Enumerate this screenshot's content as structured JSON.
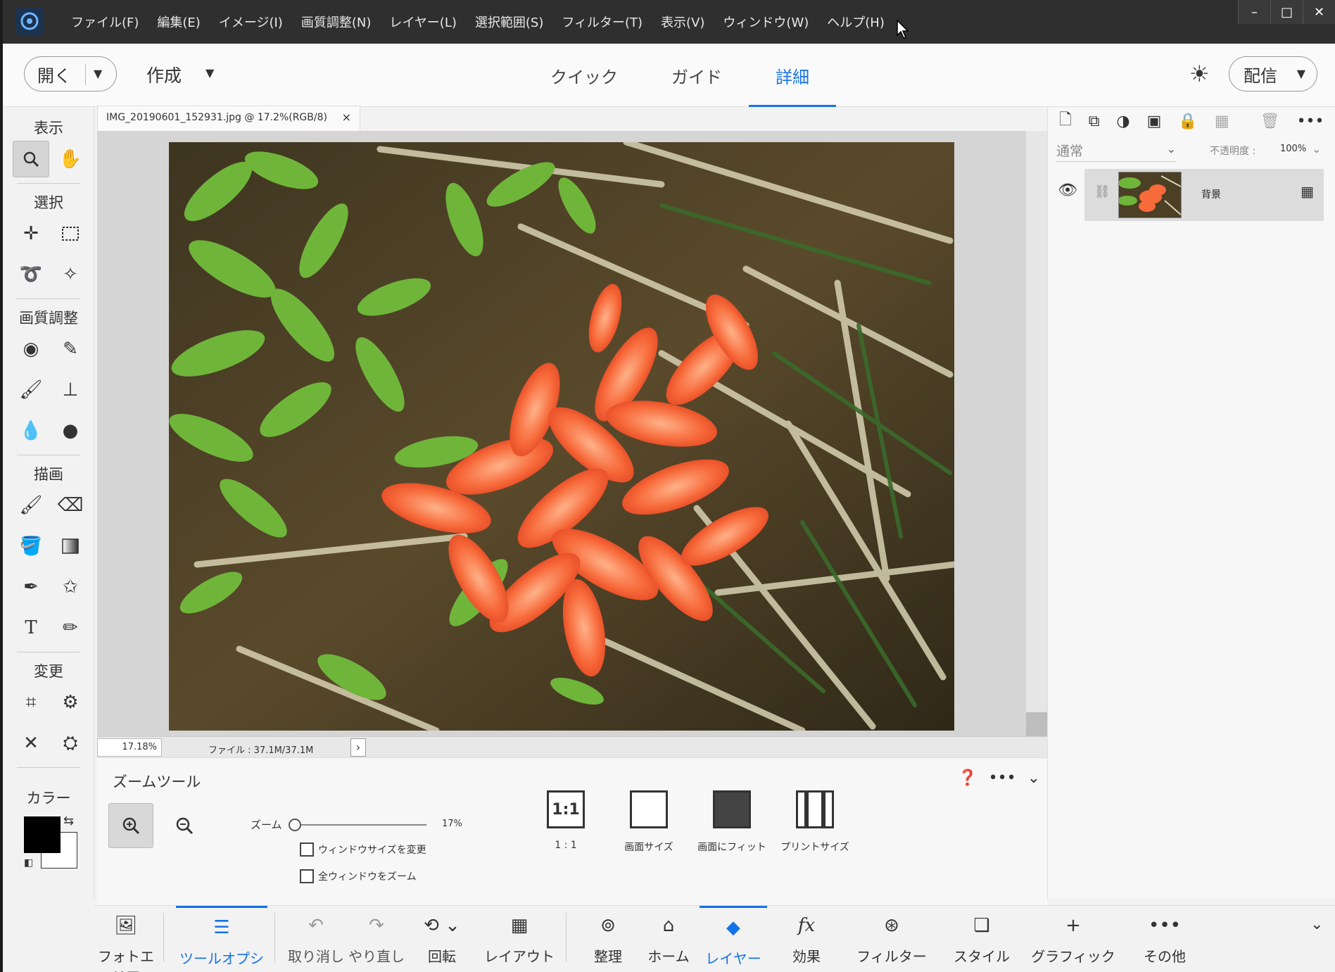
{
  "menu": [
    "ファイル(F)",
    "編集(E)",
    "イメージ(I)",
    "画質調整(N)",
    "レイヤー(L)",
    "選択範囲(S)",
    "フィルター(T)",
    "表示(V)",
    "ウィンドウ(W)",
    "ヘルプ(H)"
  ],
  "window_controls": {
    "minimize": "–",
    "maximize": "□",
    "close": "✕"
  },
  "topbar": {
    "open_label": "開く",
    "create_label": "作成",
    "modes": [
      "クイック",
      "ガイド",
      "詳細"
    ],
    "active_mode": "詳細",
    "share_label": "配信"
  },
  "toolbox": {
    "sections": {
      "view": "表示",
      "select": "選択",
      "enhance": "画質調整",
      "draw": "描画",
      "modify": "変更",
      "color": "カラー"
    }
  },
  "document": {
    "tab_title": "IMG_20190601_152931.jpg @ 17.2%(RGB/8)",
    "zoom_value": "17.18%",
    "file_info": "ファイル : 37.1M/37.1M"
  },
  "tool_options": {
    "title": "ズームツール",
    "zoom_label": "ズーム",
    "zoom_percent": "17%",
    "zoom_slider_value": 0.17,
    "checkbox_resize": "ウィンドウサイズを変更",
    "checkbox_all_windows": "全ウィンドウをズーム",
    "buttons": {
      "one_to_one": "1 : 1",
      "one_to_one_icon": "1:1",
      "screen_size": "画面サイズ",
      "fit_screen": "画面にフィット",
      "print_size": "プリントサイズ"
    }
  },
  "layers": {
    "blend_mode": "通常",
    "opacity_label": "不透明度 :",
    "opacity_value": "100%",
    "layer_name": "背景"
  },
  "taskbar": {
    "photo_bin": "フォトエリア",
    "tool_options": "ツールオプション",
    "undo": "取り消し",
    "redo": "やり直し",
    "rotate": "回転",
    "layout": "レイアウト",
    "organize": "整理",
    "home": "ホーム",
    "layers": "レイヤー",
    "effects": "効果",
    "filters": "フィルター",
    "styles": "スタイル",
    "graphics": "グラフィック",
    "more": "その他"
  },
  "colors": {
    "accent": "#1473e6",
    "titlebar": "#2f2f2f",
    "foreground": "#000000",
    "background": "#ffffff"
  }
}
